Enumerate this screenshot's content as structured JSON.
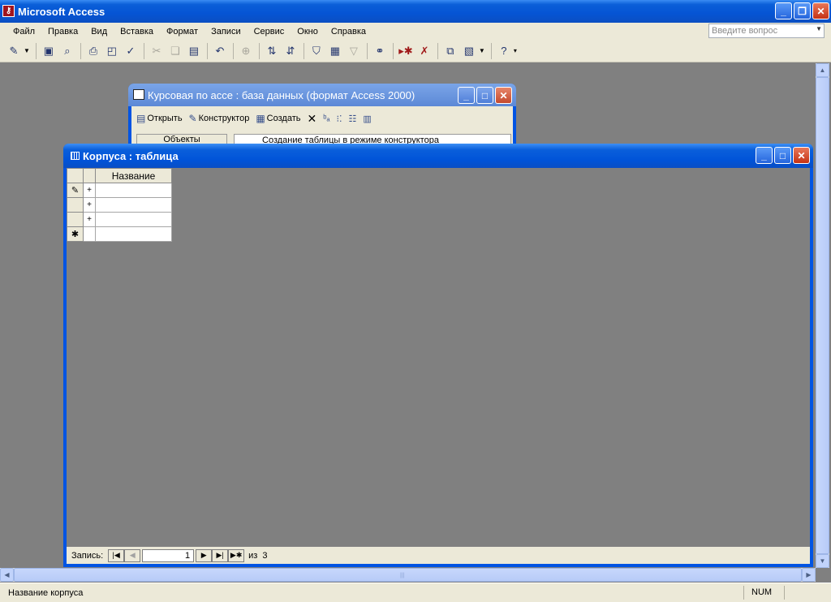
{
  "app": {
    "title": "Microsoft Access"
  },
  "menu": [
    "Файл",
    "Правка",
    "Вид",
    "Вставка",
    "Формат",
    "Записи",
    "Сервис",
    "Окно",
    "Справка"
  ],
  "help": {
    "placeholder": "Введите вопрос"
  },
  "toolbar_icons": [
    "view-icon",
    "save-icon",
    "find-icon",
    "print-icon",
    "print-preview-icon",
    "spelling-icon",
    "cut-icon",
    "copy-icon",
    "paste-icon",
    "undo-icon",
    "hyperlink-icon",
    "sort-ascending-icon",
    "sort-descending-icon",
    "filter-by-selection-icon",
    "filter-by-form-icon",
    "apply-filter-icon",
    "binoculars-icon",
    "new-record-icon",
    "delete-record-icon",
    "database-window-icon",
    "new-object-icon",
    "help-icon"
  ],
  "db_window": {
    "title": "Курсовая по асce : база данных (формат Access 2000)",
    "open_label": "Открыть",
    "design_label": "Конструктор",
    "create_label": "Создать",
    "objects_label": "Объекты",
    "item_text": "Создание таблицы в режиме конструктора"
  },
  "table_window": {
    "title": "Корпуса : таблица",
    "column_header": "Название",
    "rows": [
      {
        "selector": "✎",
        "expand": "+",
        "value": ""
      },
      {
        "selector": "",
        "expand": "+",
        "value": ""
      },
      {
        "selector": "",
        "expand": "+",
        "value": ""
      },
      {
        "selector": "✱",
        "expand": "",
        "value": ""
      }
    ],
    "nav": {
      "label": "Запись:",
      "current": "1",
      "of_label": "из",
      "total": "3"
    }
  },
  "status": {
    "text": "Название корпуса",
    "num": "NUM"
  }
}
